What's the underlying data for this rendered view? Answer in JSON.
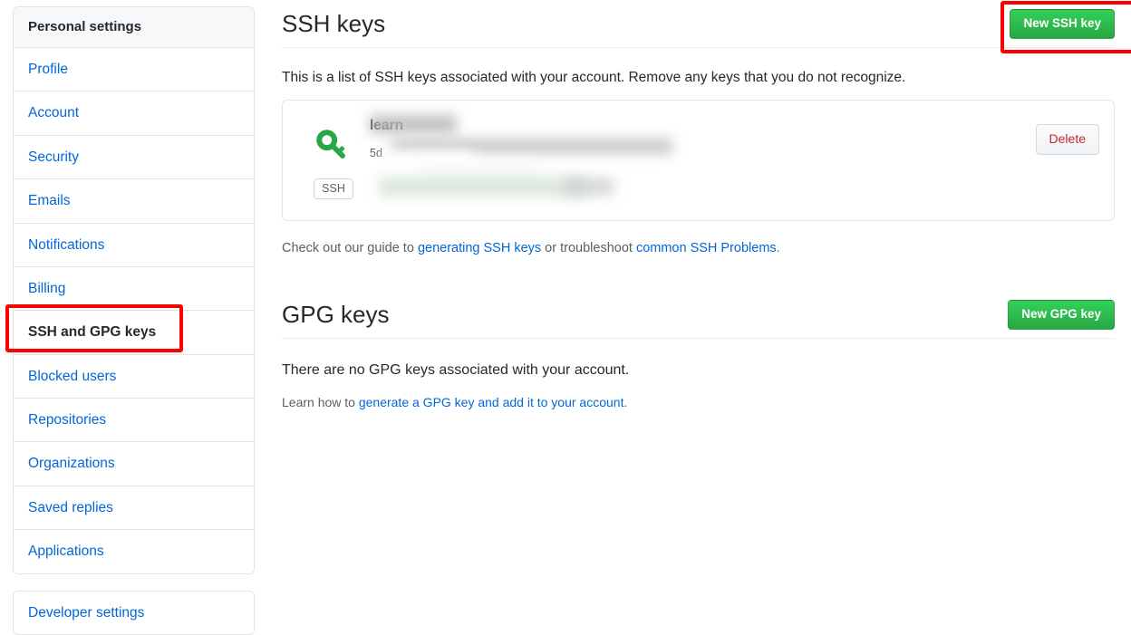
{
  "sidebar": {
    "header": "Personal settings",
    "items": [
      {
        "label": "Profile",
        "selected": false
      },
      {
        "label": "Account",
        "selected": false
      },
      {
        "label": "Security",
        "selected": false
      },
      {
        "label": "Emails",
        "selected": false
      },
      {
        "label": "Notifications",
        "selected": false
      },
      {
        "label": "Billing",
        "selected": false
      },
      {
        "label": "SSH and GPG keys",
        "selected": true
      },
      {
        "label": "Blocked users",
        "selected": false
      },
      {
        "label": "Repositories",
        "selected": false
      },
      {
        "label": "Organizations",
        "selected": false
      },
      {
        "label": "Saved replies",
        "selected": false
      },
      {
        "label": "Applications",
        "selected": false
      }
    ],
    "developer_settings": "Developer settings"
  },
  "ssh_section": {
    "title": "SSH keys",
    "new_key_button": "New SSH key",
    "description": "This is a list of SSH keys associated with your account. Remove any keys that you do not recognize.",
    "key_entry": {
      "icon": "key-icon",
      "type_badge": "SSH",
      "title_visible_fragment": "learn",
      "meta_visible_fragment": "5d",
      "delete_button": "Delete",
      "redacted": true
    },
    "footer_note": {
      "prefix": "Check out our guide to ",
      "link1": "generating SSH keys",
      "middle": " or troubleshoot ",
      "link2": "common SSH Problems",
      "suffix": "."
    }
  },
  "gpg_section": {
    "title": "GPG keys",
    "new_key_button": "New GPG key",
    "empty_message": "There are no GPG keys associated with your account.",
    "learn_note": {
      "prefix": "Learn how to ",
      "link": "generate a GPG key and add it to your account",
      "suffix": "."
    }
  },
  "annotations": {
    "highlight_color": "#ff0000",
    "highlighted_sidebar_item": "SSH and GPG keys",
    "highlighted_button": "New SSH key"
  },
  "colors": {
    "green_button": "#28a745",
    "link_blue": "#0366d6",
    "delete_red": "#cb2431",
    "text": "#24292e",
    "muted": "#586069",
    "border": "#e1e4e8",
    "header_bg": "#f6f8fa"
  }
}
